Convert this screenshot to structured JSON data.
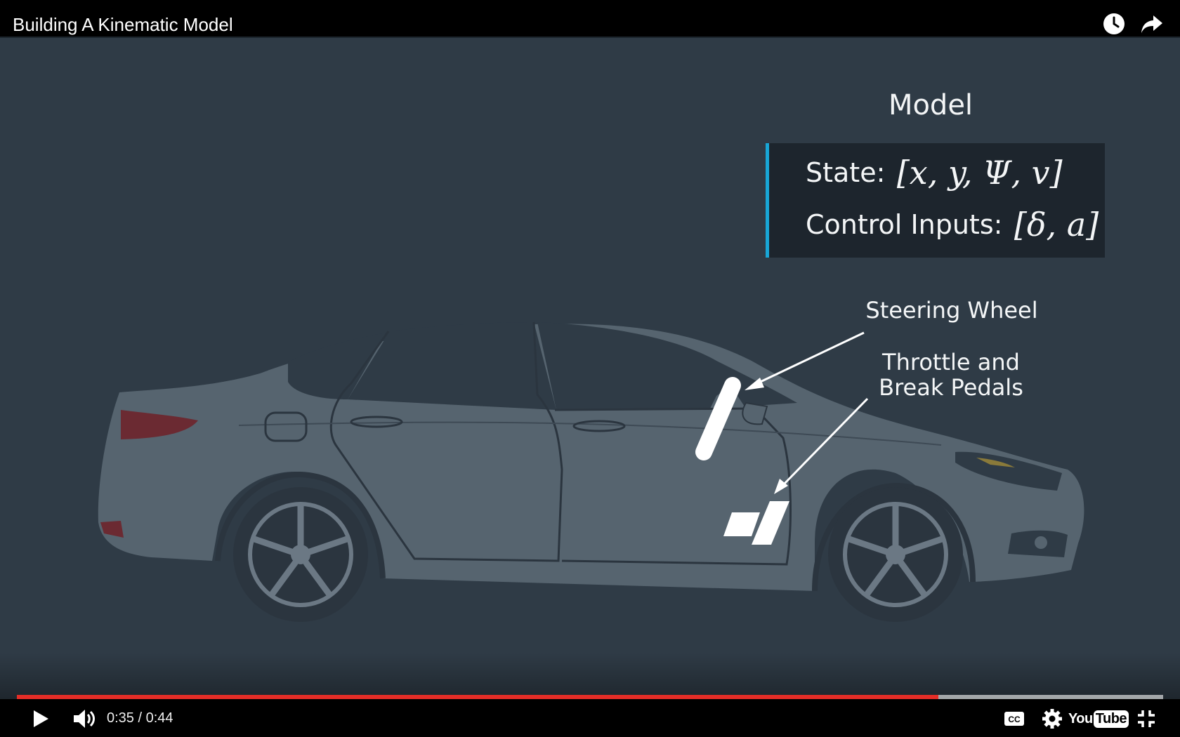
{
  "header": {
    "title": "Building A Kinematic Model",
    "watch_later_icon": "clock-icon",
    "share_icon": "share-arrow-icon"
  },
  "slide": {
    "model_title": "Model",
    "state_label": "State:",
    "state_formula": "[x, y, Ψ, v]",
    "control_label": "Control Inputs:",
    "control_formula": "[δ, a]",
    "steering_callout": "Steering Wheel",
    "pedals_callout_line1": "Throttle and",
    "pedals_callout_line2": "Break Pedals",
    "accent_color": "#18a6d6",
    "background_color": "#2f3b46",
    "car_color": "#56646f"
  },
  "player": {
    "current_time": "0:35",
    "time_separator": " / ",
    "duration": "0:44",
    "played_fraction": 0.804,
    "loaded_fraction": 1.0,
    "progress_color": "#e52d27",
    "play_icon": "play-icon",
    "volume_icon": "volume-icon",
    "captions_icon": "captions-icon",
    "settings_icon": "gear-icon",
    "youtube_logo_you": "You",
    "youtube_logo_tube": "Tube",
    "exit_fullscreen_icon": "exit-fullscreen-icon"
  }
}
